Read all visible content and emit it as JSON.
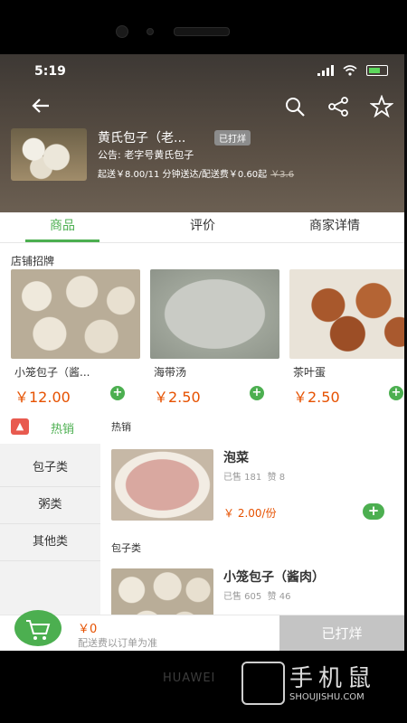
{
  "status": {
    "time": "5:19"
  },
  "shop": {
    "name": "黄氏包子（老...",
    "badge": "已打烊",
    "notice": "公告: 老字号黄氏包子",
    "delivery": "起送￥8.00/11 分钟送达/配送费￥0.60起",
    "delivery_old": "￥3.6"
  },
  "tabs": [
    "商品",
    "评价",
    "商家详情"
  ],
  "featured": {
    "title": "店铺招牌",
    "items": [
      {
        "name": "小笼包子（酱...",
        "price": "￥12.00"
      },
      {
        "name": "海带汤",
        "price": "￥2.50"
      },
      {
        "name": "茶叶蛋",
        "price": "￥2.50"
      }
    ]
  },
  "sidebar": {
    "hot_label": "热销",
    "hot_icon": "flame-icon",
    "items": [
      "包子类",
      "粥类",
      "其他类"
    ]
  },
  "menu": {
    "categories": [
      "热销",
      "包子类"
    ],
    "products": [
      {
        "name": "泡菜",
        "sold": "已售 181",
        "likes": "赞 8",
        "price": "￥ 2.00/份"
      },
      {
        "name": "小笼包子（酱肉）",
        "sold": "已售 605",
        "likes": "赞 46"
      }
    ]
  },
  "cart": {
    "price": "￥0",
    "note": "配送费以订单为准",
    "checkout": "已打烊"
  },
  "device": {
    "brand": "HUAWEI"
  },
  "watermark": {
    "cn": "手机鼠",
    "en": "SHOUJISHU.COM"
  },
  "colors": {
    "accent": "#4caf50",
    "price": "#e65100"
  }
}
